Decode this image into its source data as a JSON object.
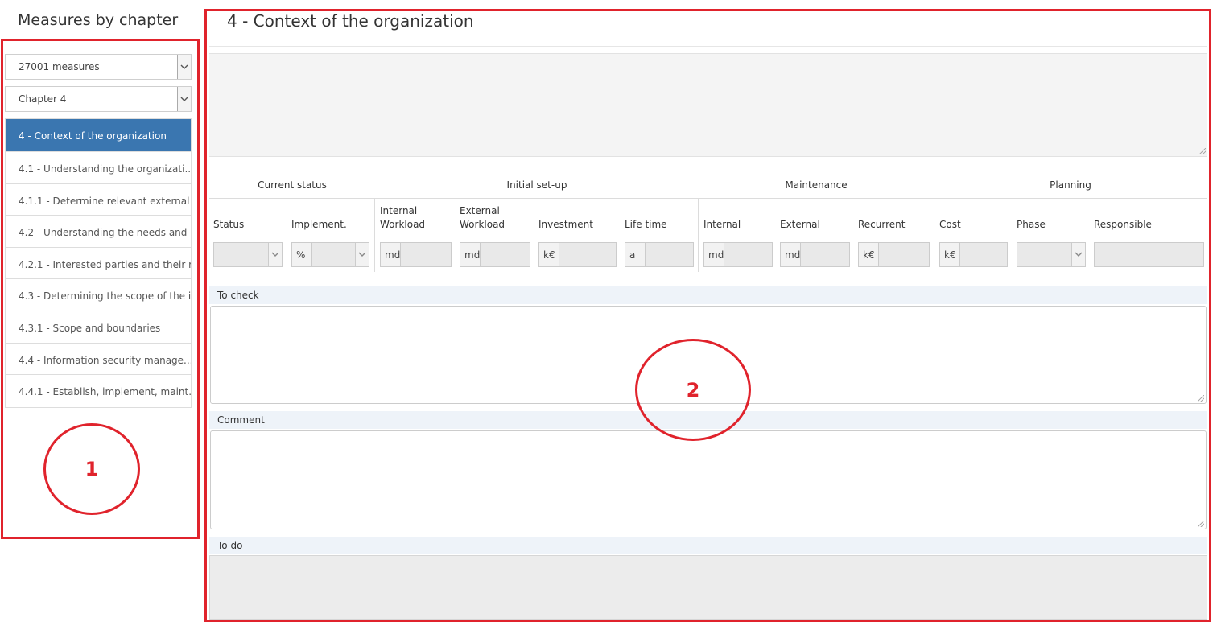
{
  "sidebar": {
    "title": "Measures by chapter",
    "measure_select": "27001 measures",
    "chapter_select": "Chapter 4",
    "items": [
      {
        "label": "4 - Context of the organization"
      },
      {
        "label": "4.1 - Understanding the organizati..."
      },
      {
        "label": "4.1.1 - Determine relevant external ..."
      },
      {
        "label": "4.2 - Understanding the needs and ..."
      },
      {
        "label": "4.2.1 - Interested parties and their r..."
      },
      {
        "label": "4.3 - Determining the scope of the i..."
      },
      {
        "label": "4.3.1 - Scope and boundaries"
      },
      {
        "label": "4.4 - Information security manage..."
      },
      {
        "label": "4.4.1 - Establish, implement, maint..."
      }
    ]
  },
  "annotations": {
    "one": "1",
    "two": "2"
  },
  "main": {
    "title": "4 - Context of the organization",
    "groups": {
      "current_status": "Current status",
      "initial_setup": "Initial set-up",
      "maintenance": "Maintenance",
      "planning": "Planning"
    },
    "columns": {
      "status": "Status",
      "implement": "Implement.",
      "internal_workload": "Internal Workload",
      "external_workload": "External Workload",
      "investment": "Investment",
      "life_time": "Life time",
      "internal": "Internal",
      "external": "External",
      "recurrent": "Recurrent",
      "cost": "Cost",
      "phase": "Phase",
      "responsible": "Responsible"
    },
    "units": {
      "percent": "%",
      "md": "md",
      "keur": "k€",
      "a": "a"
    },
    "sections": {
      "to_check": "To check",
      "comment": "Comment",
      "to_do": "To do"
    }
  },
  "colors": {
    "annotation_red": "#e0232c",
    "active_item": "#3a76b0"
  }
}
